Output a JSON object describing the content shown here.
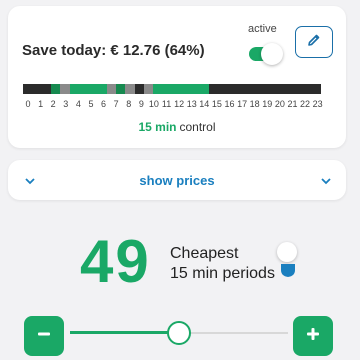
{
  "header": {
    "save_text": "Save today: € 12.76 (64%)",
    "active_label": "active",
    "toggle_on": true
  },
  "timeline": {
    "segments": [
      "dark",
      "dark",
      "dark",
      "green-dark",
      "gray",
      "green",
      "green",
      "green",
      "green",
      "gray",
      "green-dark",
      "gray",
      "dark",
      "gray",
      "green",
      "green",
      "green",
      "green",
      "green",
      "green",
      "dark",
      "dark",
      "dark",
      "dark",
      "dark",
      "dark",
      "dark",
      "dark",
      "dark",
      "dark",
      "dark",
      "dark"
    ],
    "hours": [
      "0",
      "1",
      "2",
      "3",
      "4",
      "5",
      "6",
      "7",
      "8",
      "9",
      "10",
      "11",
      "12",
      "13",
      "14",
      "15",
      "16",
      "17",
      "18",
      "19",
      "20",
      "21",
      "22",
      "23"
    ]
  },
  "control": {
    "minutes": "15 min",
    "label": "control"
  },
  "prices": {
    "label": "show prices"
  },
  "summary": {
    "count": "49",
    "line1": "Cheapest",
    "line2": "15 min periods"
  },
  "slider": {
    "fraction": 0.5
  },
  "colors": {
    "accent": "#1aa866",
    "link": "#1a7fbf",
    "dark": "#2b2b2b",
    "gray": "#8a8a8a",
    "green_dark": "#16894f"
  },
  "icons": {
    "edit": "pencil-icon",
    "expand_left": "chevron-down-icon",
    "expand_right": "chevron-down-icon",
    "minus": "minus-icon",
    "plus": "plus-icon"
  }
}
